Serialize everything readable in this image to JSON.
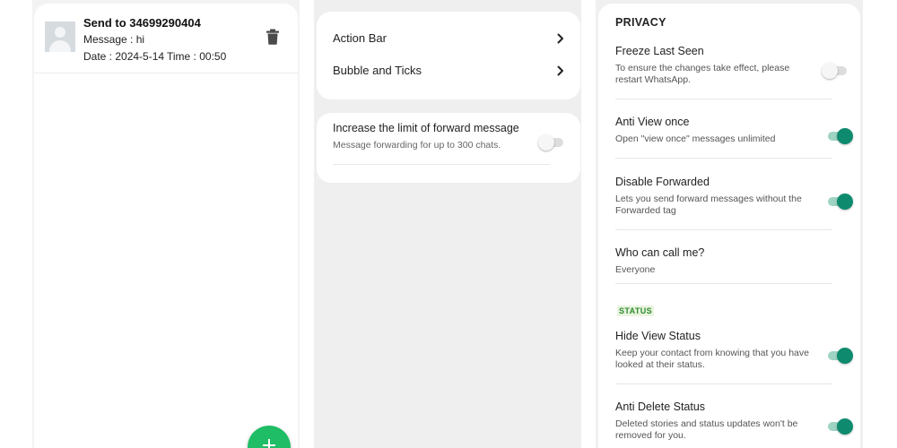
{
  "colors": {
    "accent": "#0e8a6e",
    "fab": "#1fbd66",
    "status_tag": "#2e8b2e"
  },
  "scheduled_messages": {
    "items": [
      {
        "recipient": "Send to 34699290404",
        "message": "Message : hi",
        "date": "Date : 2024-5-14",
        "time": "Time : 00:50",
        "icons": {
          "avatar": "avatar-icon",
          "delete": "trash-icon"
        }
      }
    ],
    "fab_icon": "plus-icon"
  },
  "conversation": {
    "nav_items": [
      {
        "label": "Action Bar",
        "icon": "chevron-right-icon"
      },
      {
        "label": "Bubble and Ticks",
        "icon": "chevron-right-icon"
      }
    ],
    "forward_limit": {
      "title": "Increase the limit of forward message",
      "description": "Message forwarding for up to 300 chats.",
      "enabled": false
    }
  },
  "privacy": {
    "section_title": "PRIVACY",
    "items": [
      {
        "title": "Freeze Last Seen",
        "description": "To ensure the changes take effect, please restart WhatsApp.",
        "enabled": false
      },
      {
        "title": "Anti View once",
        "description": "Open \"view once\" messages unlimited",
        "enabled": true
      },
      {
        "title": "Disable Forwarded",
        "description": "Lets you send forward messages without the Forwarded tag",
        "enabled": true
      },
      {
        "title": "Who can call me?",
        "value": "Everyone"
      }
    ],
    "status_section_title": "STATUS",
    "status_items": [
      {
        "title": "Hide View Status",
        "description": "Keep your contact from knowing that you have looked at their status.",
        "enabled": true
      },
      {
        "title": "Anti Delete Status",
        "description": "Deleted stories and status updates won't be removed for you.",
        "enabled": true
      }
    ]
  }
}
